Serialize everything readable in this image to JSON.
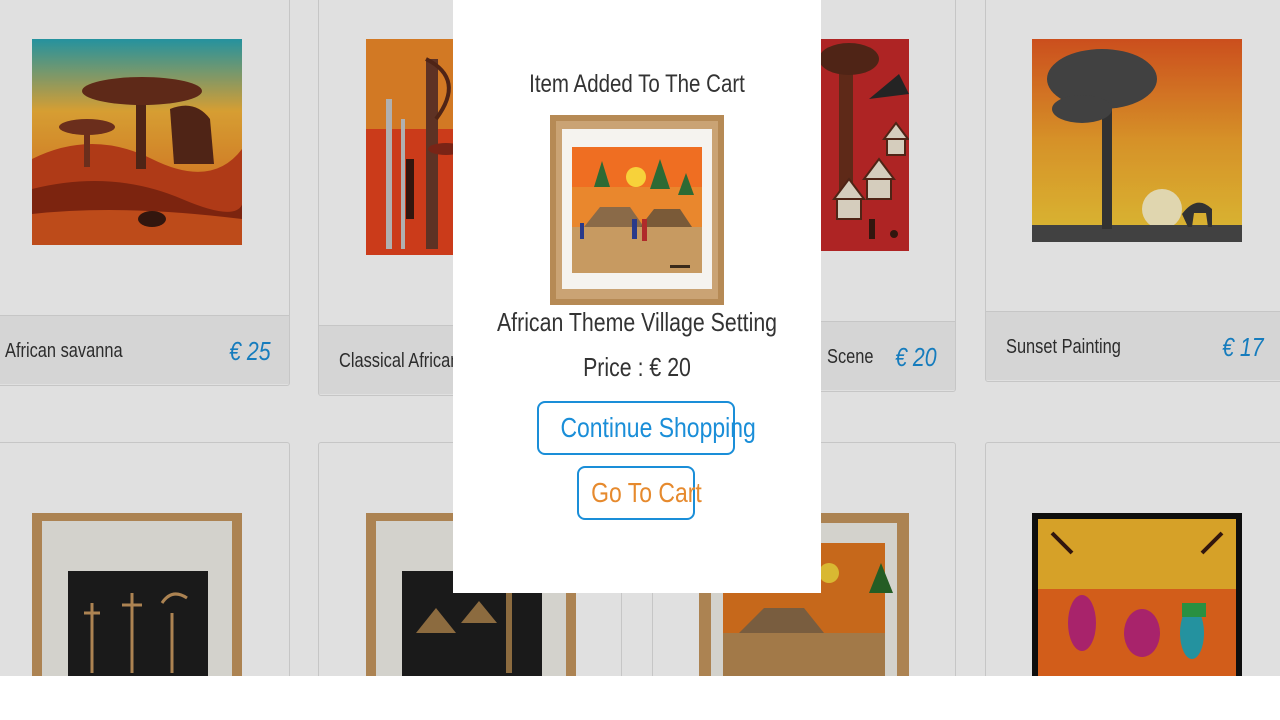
{
  "colors": {
    "accent_blue": "#1a8ed8",
    "accent_orange": "#e68a2e",
    "modal_bg": "#ffffff",
    "overlay": "rgba(0,0,0,0.12)"
  },
  "products": {
    "row1": [
      {
        "name": "African savanna",
        "price": "€ 25"
      },
      {
        "name": "Classical African",
        "price": ""
      },
      {
        "name": "Scene",
        "price": "€ 20"
      },
      {
        "name": "Sunset Painting",
        "price": "€ 17"
      }
    ]
  },
  "modal": {
    "title": "Item Added To The Cart",
    "product_name": "African Theme Village Setting",
    "price": "Price : € 20",
    "continue_label": "Continue Shopping",
    "cart_label": "Go To Cart"
  }
}
